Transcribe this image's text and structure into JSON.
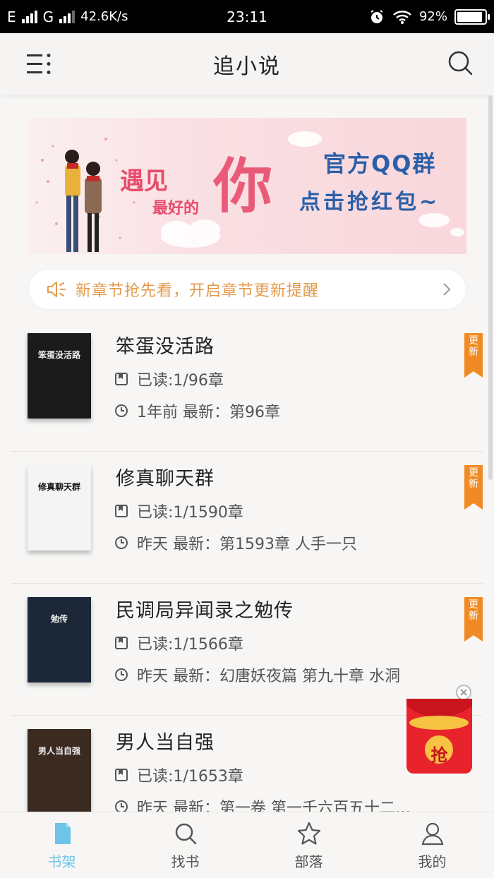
{
  "status_bar": {
    "carrier1": "E",
    "carrier2": "G",
    "speed": "42.6K/s",
    "time": "23:11",
    "battery": "92%",
    "battery_level": 0.92
  },
  "header": {
    "title": "追小说"
  },
  "banner": {
    "line1": "遇见",
    "line2": "最好的",
    "big": "你",
    "right1": "官方QQ群",
    "right2": "点击抢红包~"
  },
  "notice": {
    "text": "新章节抢先看，开启章节更新提醒"
  },
  "books": [
    {
      "title": "笨蛋没活路",
      "read": "已读:1/96章",
      "latest": "1年前  最新：第96章",
      "tag": "更新",
      "cover_text": "笨蛋没活路",
      "cover_bg": "#1b1b1b"
    },
    {
      "title": "修真聊天群",
      "read": "已读:1/1590章",
      "latest": "昨天  最新：第1593章 人手一只",
      "tag": "更新",
      "cover_text": "修真聊天群",
      "cover_bg": "#f4f4f4"
    },
    {
      "title": "民调局异闻录之勉传",
      "read": "已读:1/1566章",
      "latest": "昨天  最新：幻唐妖夜篇 第九十章  水洞",
      "tag": "更新",
      "cover_text": "勉传",
      "cover_bg": "#1c2838"
    },
    {
      "title": "男人当自强",
      "read": "已读:1/1653章",
      "latest": "昨天  最新：第一卷 第一千六百五十二…",
      "tag": "",
      "cover_text": "男人当自强",
      "cover_bg": "#3a2a20"
    }
  ],
  "redpack": {
    "label": "抢"
  },
  "tabs": [
    {
      "label": "书架",
      "active": true
    },
    {
      "label": "找书",
      "active": false
    },
    {
      "label": "部落",
      "active": false
    },
    {
      "label": "我的",
      "active": false
    }
  ],
  "colors": {
    "accent": "#6ec3e8",
    "notice_text": "#e39a4d",
    "tag": "#f08a24",
    "redpack": "#e8232c"
  }
}
